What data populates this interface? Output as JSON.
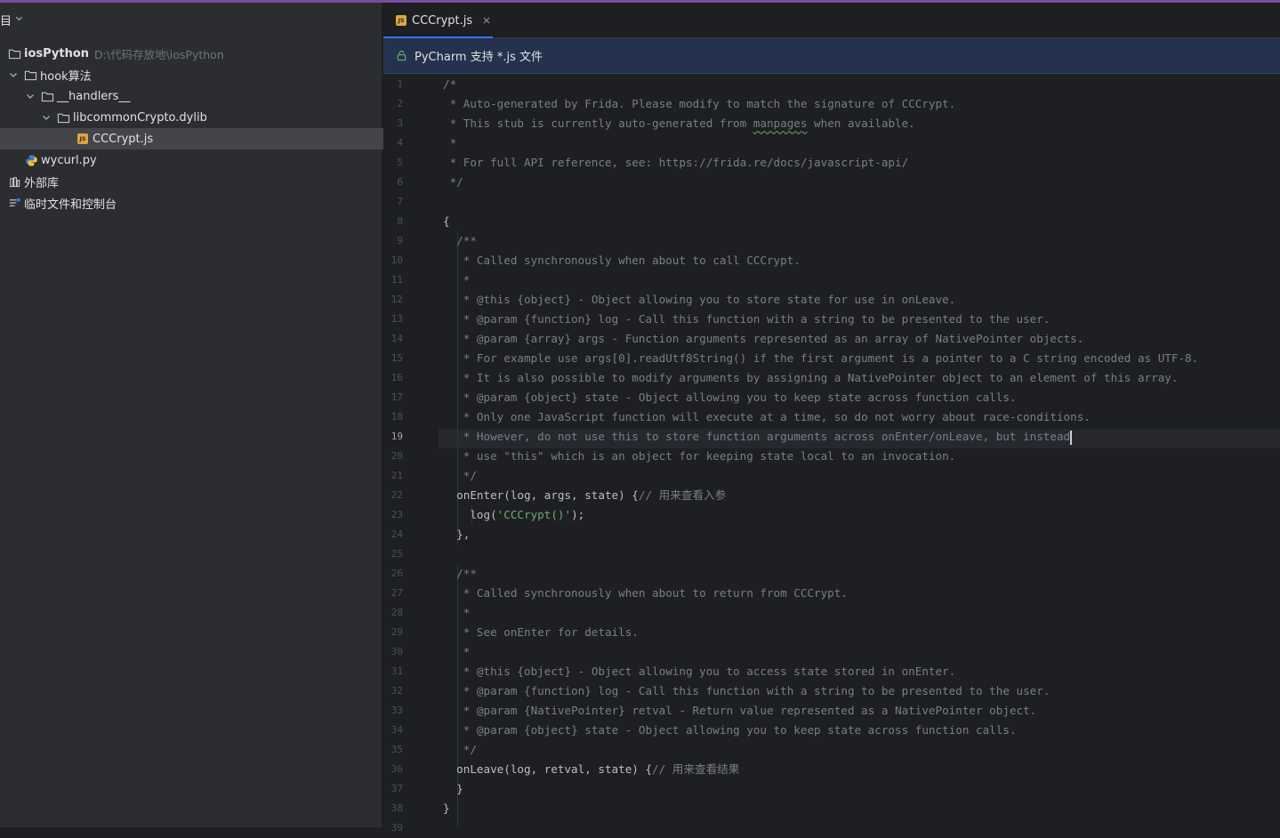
{
  "sidebar": {
    "header_title": "目",
    "tree": [
      {
        "label": "iosPython",
        "path": "D:\\代码存放地\\iosPython",
        "type": "folder",
        "depth": 0,
        "expanded": null
      },
      {
        "label": "hook算法",
        "type": "folder",
        "depth": 0,
        "expanded": true
      },
      {
        "label": "__handlers__",
        "type": "folder",
        "depth": 1,
        "expanded": true
      },
      {
        "label": "libcommonCrypto.dylib",
        "type": "folder",
        "depth": 2,
        "expanded": true
      },
      {
        "label": "CCCrypt.js",
        "type": "js",
        "depth": 4,
        "selected": true
      },
      {
        "label": "wycurl.py",
        "type": "py",
        "depth": 1
      },
      {
        "label": "外部库",
        "type": "lib",
        "depth": 0
      },
      {
        "label": "临时文件和控制台",
        "type": "scratch",
        "depth": 0
      }
    ]
  },
  "editor": {
    "tab_label": "CCCrypt.js",
    "tab_icon_text": "JS",
    "banner_text": "PyCharm 支持 *.js 文件",
    "active_line": 19,
    "line_numbers": [
      "1",
      "2",
      "3",
      "4",
      "5",
      "6",
      "7",
      "8",
      "9",
      "10",
      "11",
      "12",
      "13",
      "14",
      "15",
      "16",
      "17",
      "18",
      "19",
      "20",
      "21",
      "22",
      "23",
      "24",
      "25",
      "26",
      "27",
      "28",
      "29",
      "30",
      "31",
      "32",
      "33",
      "34",
      "35",
      "36",
      "37",
      "38",
      "39"
    ],
    "code": {
      "l1": "/*",
      "l2": " * Auto-generated by Frida. Please modify to match the signature of CCCrypt.",
      "l3a": " * This stub is currently auto-generated from ",
      "l3b": "manpages",
      "l3c": " when available.",
      "l4": " *",
      "l5": " * For full API reference, see: https://frida.re/docs/javascript-api/",
      "l6": " */",
      "l8": "{",
      "l9": "  /**",
      "l10": "   * Called synchronously when about to call CCCrypt.",
      "l11": "   *",
      "l12a": "   * ",
      "l12b": "@this {object}",
      "l12c": " - Object allowing you to store state for use in onLeave.",
      "l13a": "   * ",
      "l13b": "@param {function}",
      "l13c": " log - Call this function with a string to be presented to the user.",
      "l14a": "   * ",
      "l14b": "@param {array}",
      "l14c": " args - Function arguments represented as an array of NativePointer objects.",
      "l15": "   * For example use args[0].readUtf8String() if the first argument is a pointer to a C string encoded as UTF-8.",
      "l16": "   * It is also possible to modify arguments by assigning a NativePointer object to an element of this array.",
      "l17a": "   * ",
      "l17b": "@param {object}",
      "l17c": " state - Object allowing you to keep state across function calls.",
      "l18": "   * Only one JavaScript function will execute at a time, so do not worry about race-conditions.",
      "l19": "   * However, do not use this to store function arguments across onEnter/onLeave, but instead",
      "l20": "   * use \"this\" which is an object for keeping state local to an invocation.",
      "l21": "   */",
      "l22a": "  onEnter(log, args, state) {",
      "l22b": "// 用来查看入参",
      "l23a": "    log(",
      "l23b": "'CCCrypt()'",
      "l23c": ");",
      "l24": "  },",
      "l26": "  /**",
      "l27": "   * Called synchronously when about to return from CCCrypt.",
      "l28": "   *",
      "l29": "   * See onEnter for details.",
      "l30": "   *",
      "l31a": "   * ",
      "l31b": "@this {object}",
      "l31c": " - Object allowing you to access state stored in onEnter.",
      "l32a": "   * ",
      "l32b": "@param {function}",
      "l32c": " log - Call this function with a string to be presented to the user.",
      "l33a": "   * ",
      "l33b": "@param {NativePointer}",
      "l33c": " retval - Return value represented as a NativePointer object.",
      "l34a": "   * ",
      "l34b": "@param {object}",
      "l34c": " state - Object allowing you to keep state across function calls.",
      "l35": "   */",
      "l36a": "  onLeave(log, retval, state) {",
      "l36b": "// 用来查看结果",
      "l37": "  }",
      "l38": "}"
    }
  },
  "colors": {
    "sidebar_bg": "#2b2d30",
    "editor_bg": "#1e1f22",
    "accent": "#3574f0",
    "comment": "#7a7e85",
    "string": "#6aab73",
    "js_badge": "#e0a640"
  }
}
